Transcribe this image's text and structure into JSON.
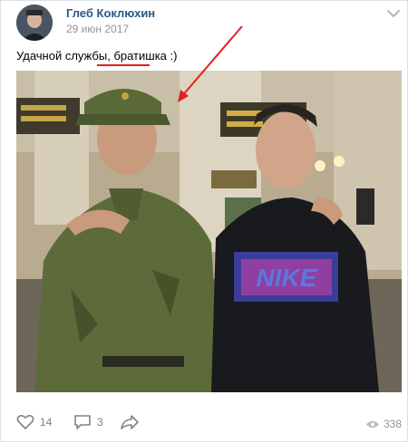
{
  "post": {
    "author": "Глеб Коклюхин",
    "date": "29 июн 2017",
    "caption_prefix": "Удачной службы,",
    "caption_highlight": "братишка",
    "caption_suffix": ":)"
  },
  "photo": {
    "shirt_text": "NIKE"
  },
  "actions": {
    "likes": "14",
    "comments": "3",
    "views": "338"
  },
  "colors": {
    "author": "#2a5885",
    "annotation": "#e02020"
  }
}
